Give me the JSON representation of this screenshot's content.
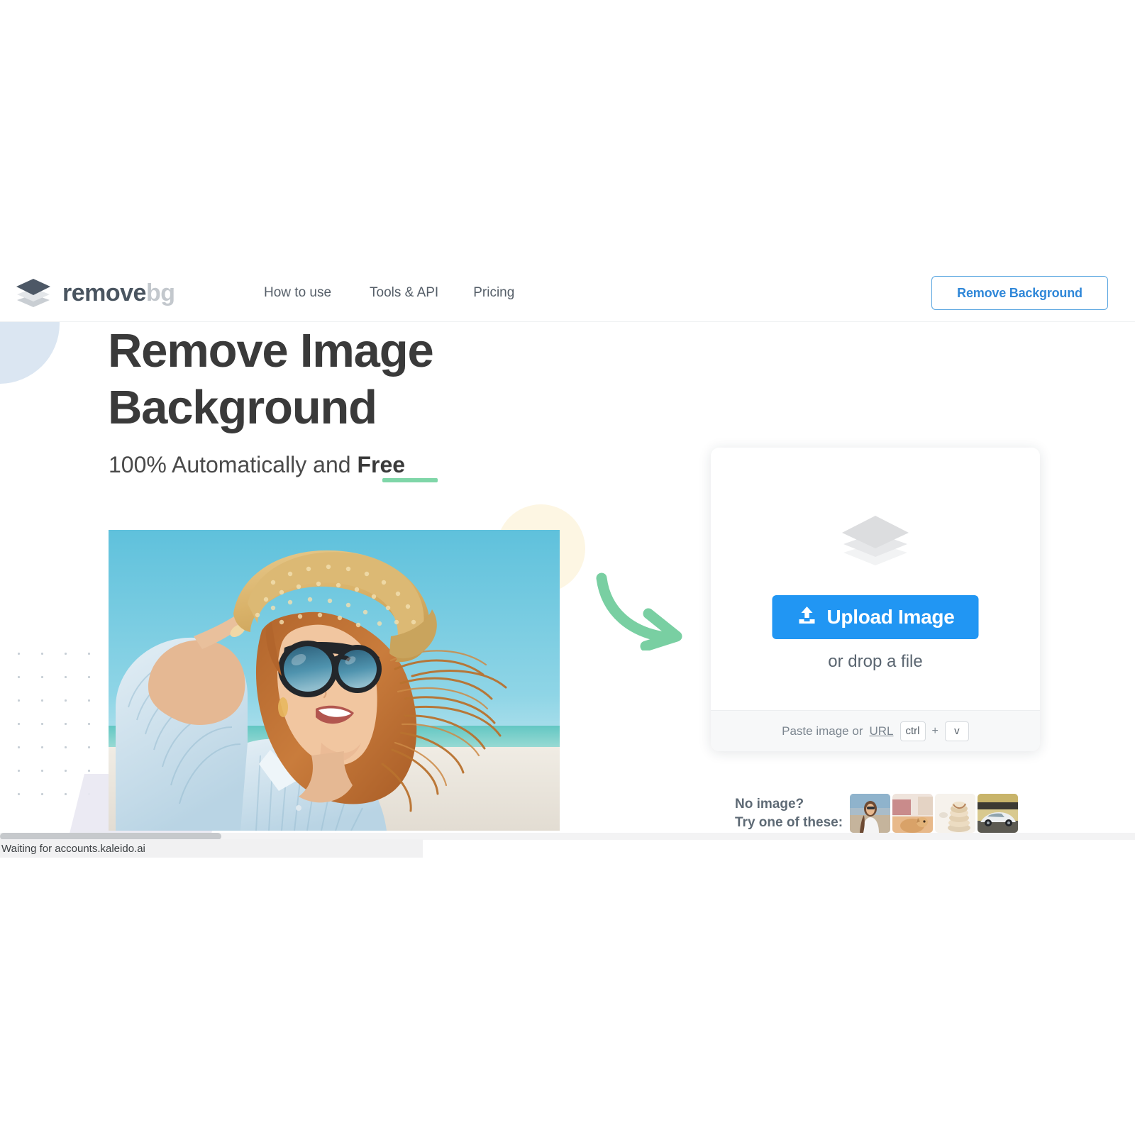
{
  "header": {
    "logo": {
      "icon": "layers-stack-icon",
      "text_dark": "remove",
      "text_light": "bg"
    },
    "nav": [
      {
        "label": "How to use"
      },
      {
        "label": "Tools & API"
      },
      {
        "label": "Pricing"
      }
    ],
    "cta": {
      "label": "Remove Background"
    }
  },
  "hero": {
    "title_line1": "Remove Image",
    "title_line2": "Background",
    "subtitle_prefix": "100% Automatically and ",
    "subtitle_highlight": "Free",
    "photo_alt": "woman-in-straw-hat-and-sunglasses-at-beach"
  },
  "upload": {
    "icon": "layers-stack-icon",
    "button_label": "Upload Image",
    "button_icon": "upload-icon",
    "drop_text": "or drop a file",
    "paste_label": "Paste image or",
    "paste_url_label": "URL",
    "key_ctrl": "ctrl",
    "key_plus": "+",
    "key_v": "v"
  },
  "samples": {
    "label_line1": "No image?",
    "label_line2": "Try one of these:",
    "thumbs": [
      {
        "name": "sample-woman-portrait"
      },
      {
        "name": "sample-dog-on-couch"
      },
      {
        "name": "sample-stacked-pancakes"
      },
      {
        "name": "sample-sports-car"
      }
    ]
  },
  "browser": {
    "status_text": "Waiting for accounts.kaleido.ai"
  },
  "colors": {
    "accent_blue": "#2196f3",
    "link_blue": "#2f87d8",
    "green": "#7fd6a8",
    "text_dark": "#3a3a3a",
    "text_muted": "#7b858f"
  }
}
